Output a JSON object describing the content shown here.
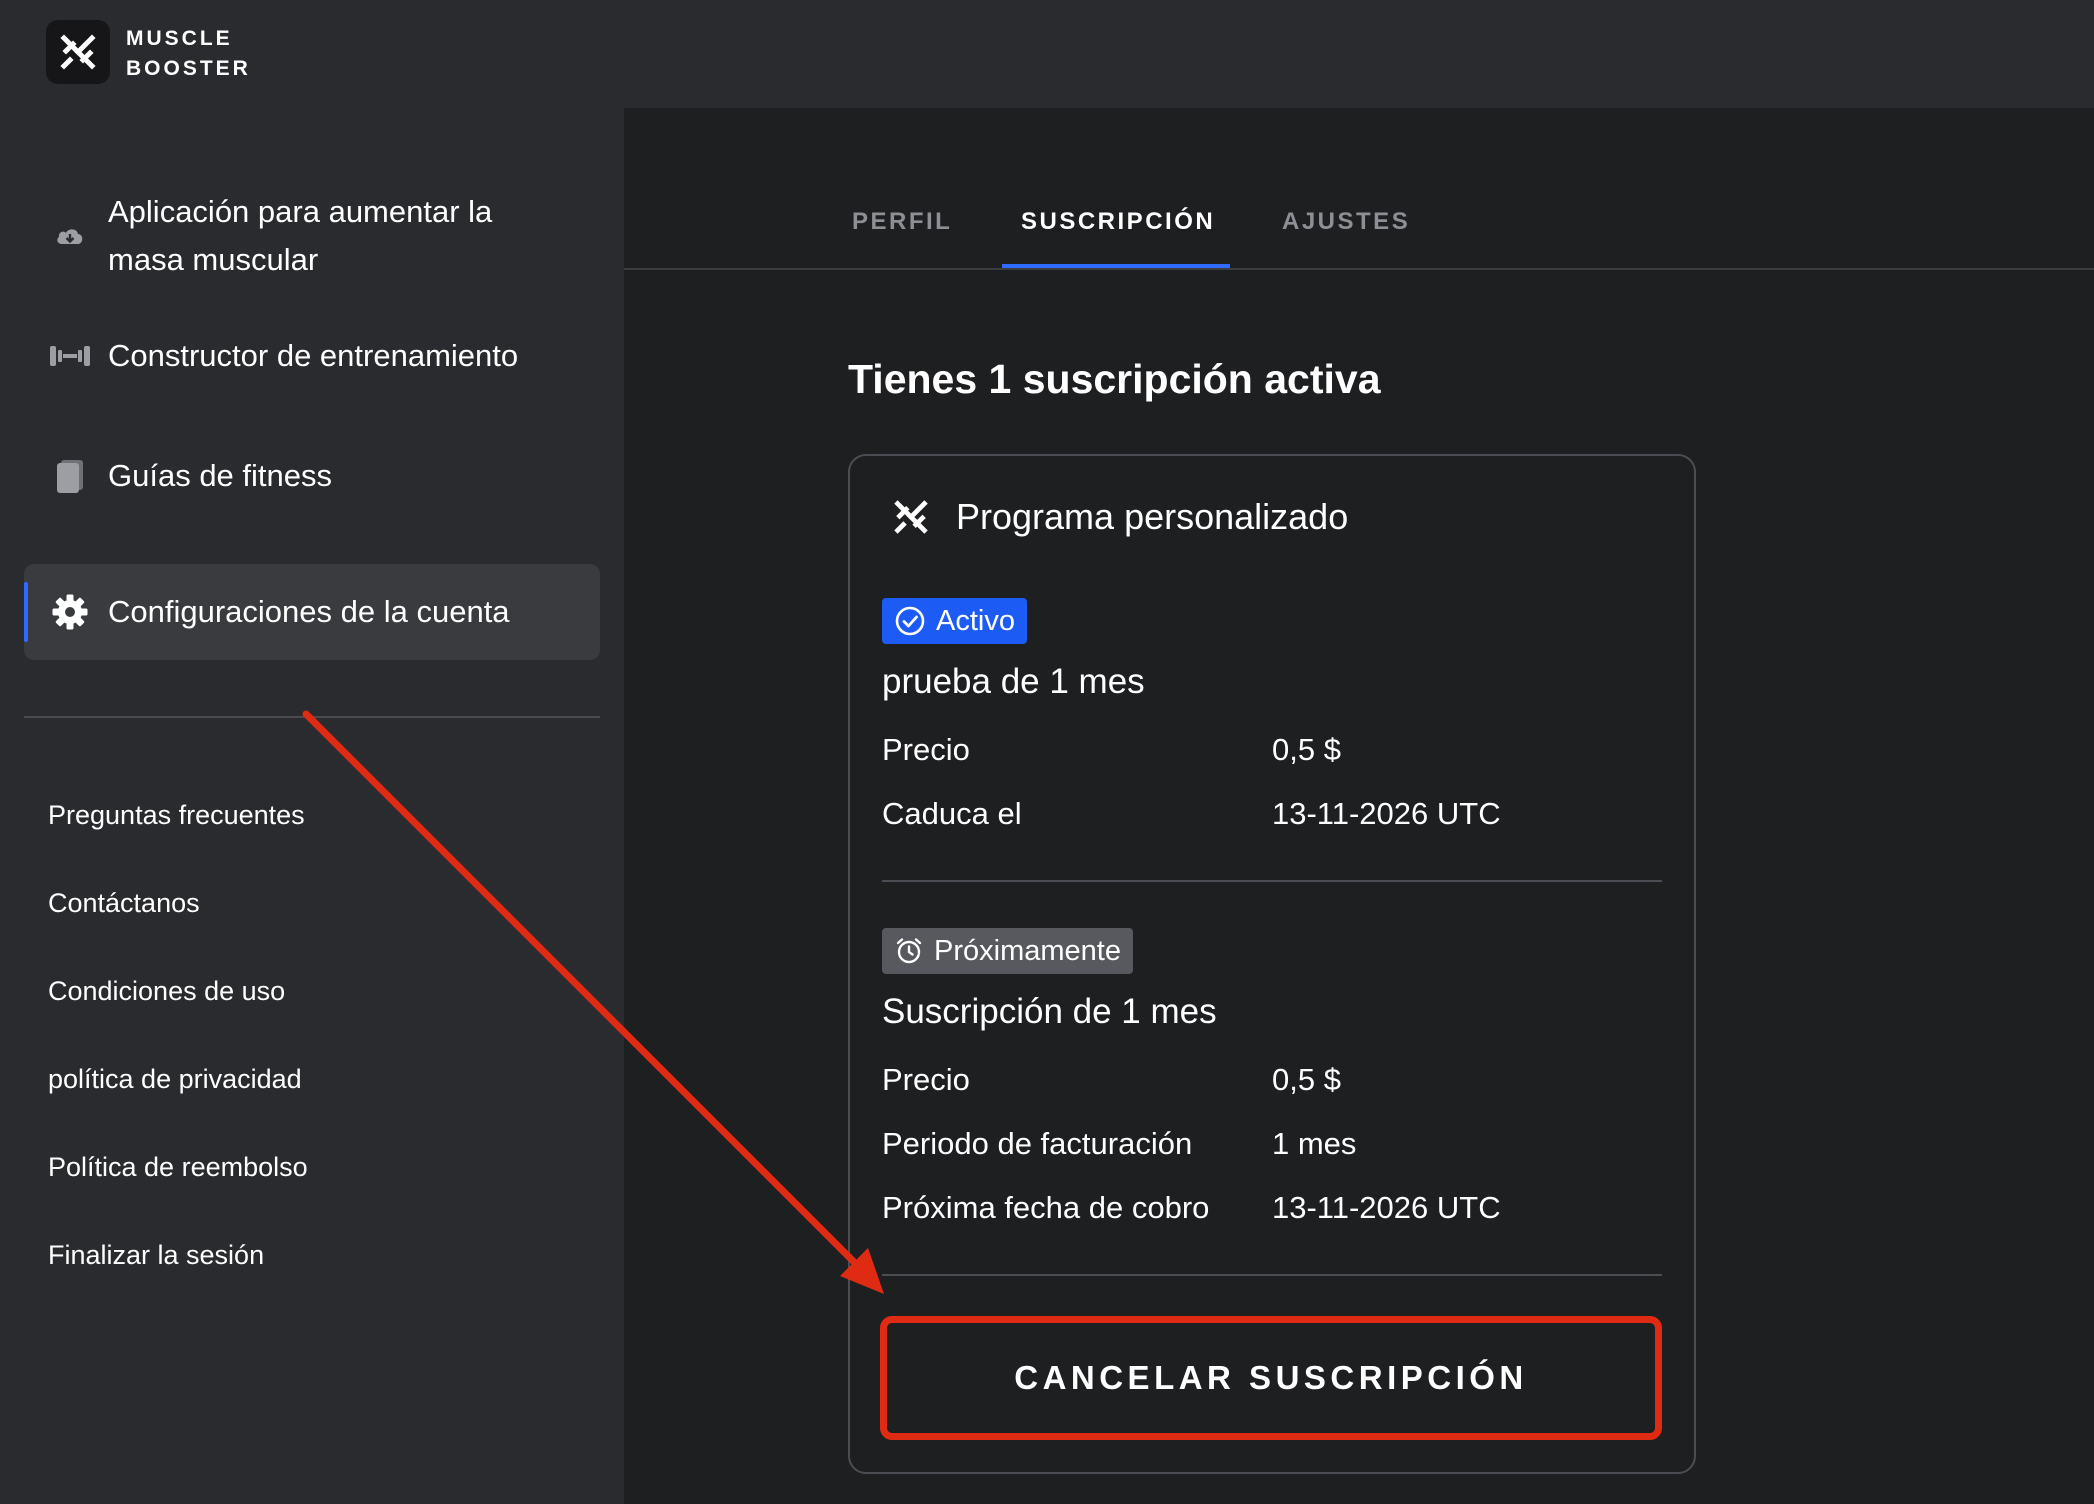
{
  "brand": {
    "line1": "MUSCLE",
    "line2": "BOOSTER",
    "logo_icon": "muscle-booster-logo-icon"
  },
  "sidebar": {
    "items": [
      {
        "label": "Aplicación para aumentar la masa muscular",
        "icon": "download-cloud-icon",
        "active": false
      },
      {
        "label": "Constructor de entrenamiento",
        "icon": "dumbbell-icon",
        "active": false
      },
      {
        "label": "Guías de fitness",
        "icon": "document-icon",
        "active": false
      },
      {
        "label": "Configuraciones de la cuenta",
        "icon": "gear-icon",
        "active": true
      }
    ],
    "links": [
      "Preguntas frecuentes",
      "Contáctanos",
      "Condiciones de uso",
      "política de privacidad",
      "Política de reembolso",
      "Finalizar la sesión"
    ]
  },
  "tabs": [
    {
      "label": "PERFIL",
      "active": false
    },
    {
      "label": "SUSCRIPCIÓN",
      "active": true
    },
    {
      "label": "AJUSTES",
      "active": false
    }
  ],
  "main": {
    "heading": "Tienes 1 suscripción activa",
    "card": {
      "title": "Programa personalizado",
      "current": {
        "badge": "Activo",
        "plan": "prueba de 1 mes",
        "rows": [
          {
            "label": "Precio",
            "value": "0,5 $"
          },
          {
            "label": "Caduca el",
            "value": "13-11-2026 UTC"
          }
        ]
      },
      "upcoming": {
        "badge": "Próximamente",
        "plan": "Suscripción de 1 mes",
        "rows": [
          {
            "label": "Precio",
            "value": "0,5 $"
          },
          {
            "label": "Periodo de facturación",
            "value": "1 mes"
          },
          {
            "label": "Próxima fecha de cobro",
            "value": "13-11-2026 UTC"
          }
        ]
      },
      "cancel_label": "CANCELAR SUSCRIPCIÓN"
    }
  },
  "colors": {
    "accent_blue": "#2f6bff",
    "active_badge": "#1c5cf5",
    "annotation_red": "#e02b14",
    "sidebar_bg": "#2a2b2e",
    "main_bg": "#1e1f21"
  }
}
